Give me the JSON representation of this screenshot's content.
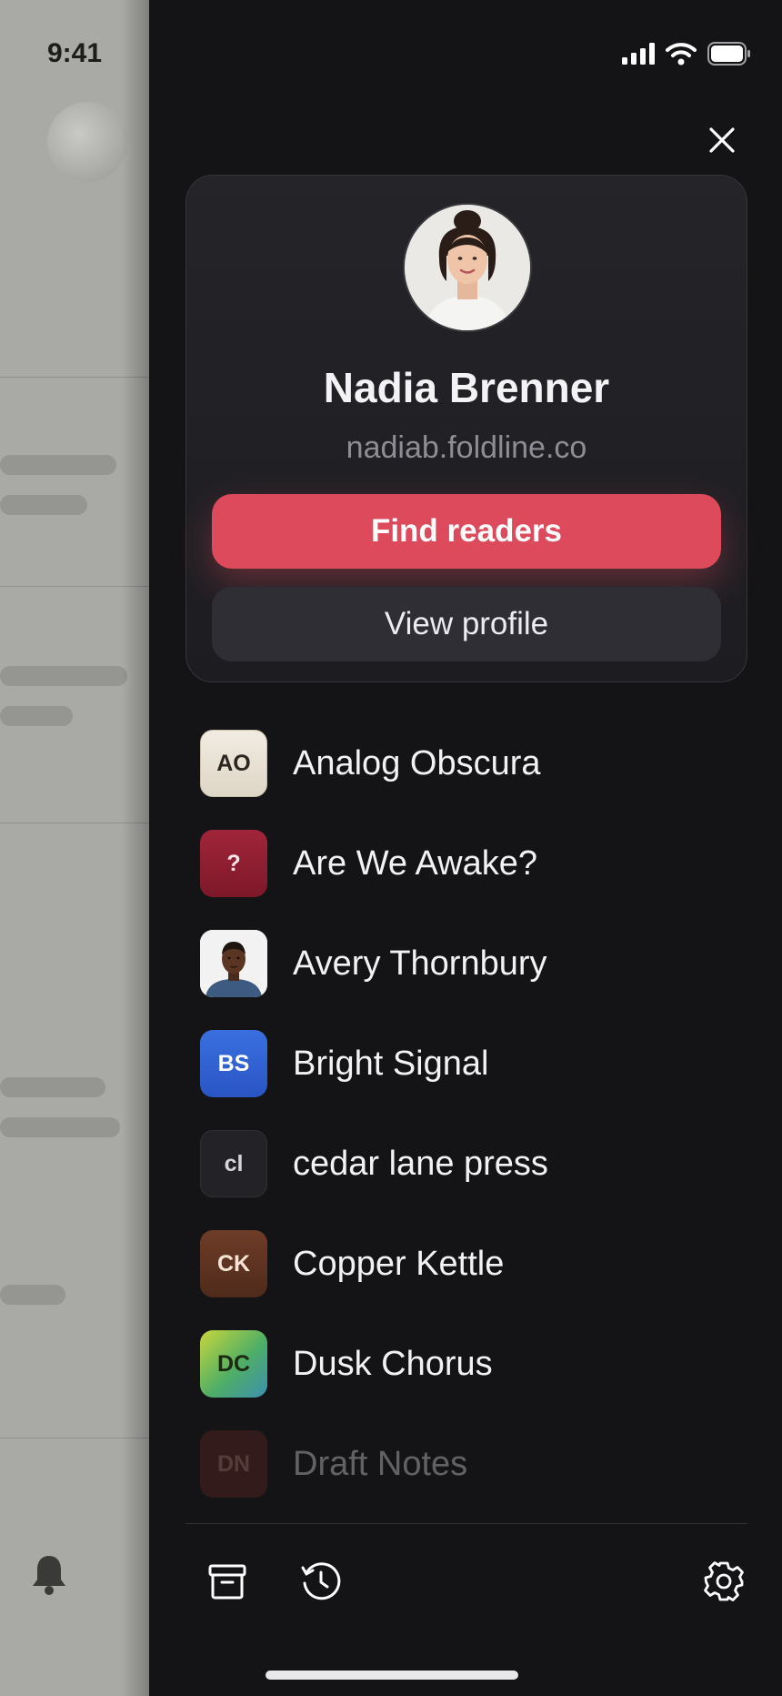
{
  "status_bar": {
    "time": "9:41"
  },
  "profile": {
    "name": "Nadia Brenner",
    "handle": "nadiab.foldline.co",
    "primary_button": "Find readers",
    "secondary_button": "View profile"
  },
  "publications": [
    {
      "initials": "AO",
      "label": "Analog Obscura",
      "style": "cream"
    },
    {
      "initials": "?",
      "label": "Are We Awake?",
      "style": "crimson"
    },
    {
      "initials": "",
      "label": "Avery Thornbury",
      "style": "photo"
    },
    {
      "initials": "BS",
      "label": "Bright Signal",
      "style": "blue"
    },
    {
      "initials": "cl",
      "label": "cedar lane press",
      "style": "dark"
    },
    {
      "initials": "CK",
      "label": "Copper Kettle",
      "style": "brown"
    },
    {
      "initials": "DC",
      "label": "Dusk Chorus",
      "style": "gradient"
    },
    {
      "initials": "DN",
      "label": "Draft Notes",
      "style": "faded"
    }
  ],
  "colors": {
    "accent": "#dc4a5c",
    "drawer_background": "#141416",
    "card_background": "#242429"
  },
  "icons": [
    "cellular-icon",
    "wifi-icon",
    "battery-icon",
    "close-icon",
    "bell-icon",
    "archive-icon",
    "history-icon",
    "settings-icon"
  ]
}
